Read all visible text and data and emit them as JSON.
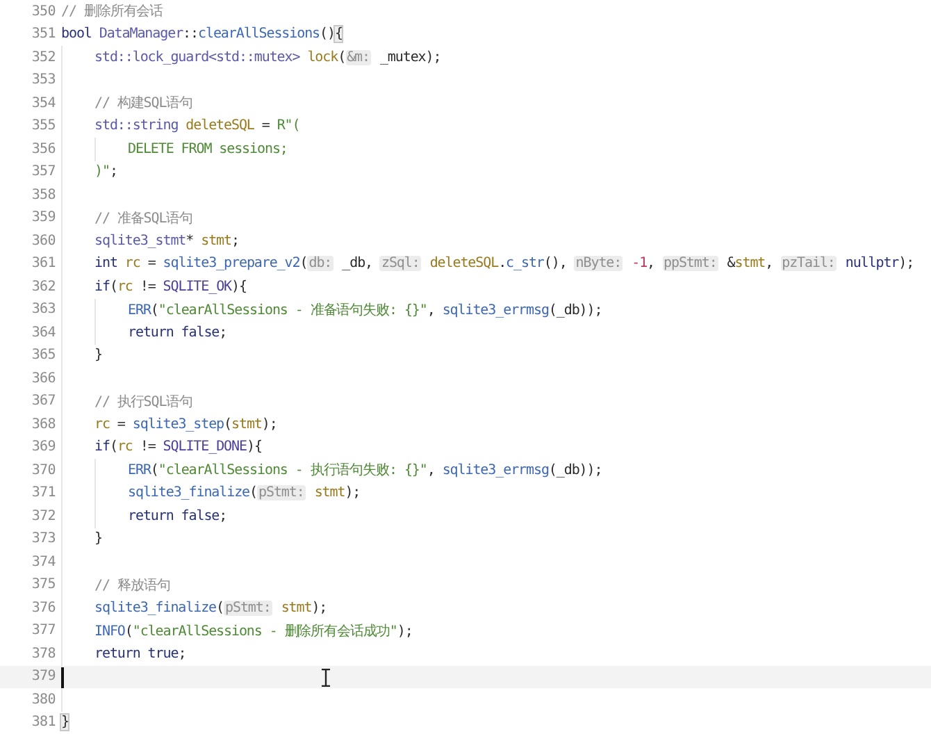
{
  "editor": {
    "lines": [
      {
        "number": "350",
        "current": false,
        "tokens": [
          {
            "kind": "comment",
            "t": "// 删除所有会话"
          }
        ]
      },
      {
        "number": "351",
        "current": false,
        "tokens": [
          {
            "kind": "kw",
            "t": "bool "
          },
          {
            "kind": "type",
            "t": "DataManager"
          },
          {
            "kind": "plain",
            "t": "::"
          },
          {
            "kind": "fn",
            "t": "clearAllSessions"
          },
          {
            "kind": "plain",
            "t": "()"
          },
          {
            "kind": "brace",
            "t": "{"
          }
        ]
      },
      {
        "number": "352",
        "current": false,
        "tokens": [
          {
            "kind": "type",
            "t": "    std::lock_guard<std::mutex> "
          },
          {
            "kind": "var",
            "t": "lock"
          },
          {
            "kind": "plain",
            "t": "("
          },
          {
            "kind": "hint",
            "t": "&m:"
          },
          {
            "kind": "plain",
            "t": " _mutex);"
          }
        ]
      },
      {
        "number": "353",
        "current": false
      },
      {
        "number": "354",
        "current": false,
        "tokens": [
          {
            "kind": "comment",
            "t": "    // 构建SQL语句"
          }
        ]
      },
      {
        "number": "355",
        "current": false,
        "tokens": [
          {
            "kind": "type",
            "t": "    std::string "
          },
          {
            "kind": "var",
            "t": "deleteSQL"
          },
          {
            "kind": "plain",
            "t": " = "
          },
          {
            "kind": "str",
            "t": "R\"("
          }
        ]
      },
      {
        "number": "356",
        "current": false,
        "tokens": [
          {
            "kind": "str",
            "t": "        DELETE FROM sessions;"
          }
        ]
      },
      {
        "number": "357",
        "current": false,
        "tokens": [
          {
            "kind": "str",
            "t": "    )\""
          },
          {
            "kind": "plain",
            "t": ";"
          }
        ]
      },
      {
        "number": "358",
        "current": false
      },
      {
        "number": "359",
        "current": false,
        "tokens": [
          {
            "kind": "comment",
            "t": "    // 准备SQL语句"
          }
        ]
      },
      {
        "number": "360",
        "current": false,
        "tokens": [
          {
            "kind": "type",
            "t": "    sqlite3_stmt"
          },
          {
            "kind": "plain",
            "t": "* "
          },
          {
            "kind": "var",
            "t": "stmt"
          },
          {
            "kind": "plain",
            "t": ";"
          }
        ]
      },
      {
        "number": "361",
        "current": false,
        "tokens": [
          {
            "kind": "kw",
            "t": "    int "
          },
          {
            "kind": "var",
            "t": "rc"
          },
          {
            "kind": "plain",
            "t": " = "
          },
          {
            "kind": "fn",
            "t": "sqlite3_prepare_v2"
          },
          {
            "kind": "plain",
            "t": "("
          },
          {
            "kind": "hint",
            "t": "db:"
          },
          {
            "kind": "plain",
            "t": " _db, "
          },
          {
            "kind": "hint",
            "t": "zSql:"
          },
          {
            "kind": "var",
            "t": " deleteSQL"
          },
          {
            "kind": "plain",
            "t": "."
          },
          {
            "kind": "fn",
            "t": "c_str"
          },
          {
            "kind": "plain",
            "t": "(), "
          },
          {
            "kind": "hint",
            "t": "nByte:"
          },
          {
            "kind": "num",
            "t": " -1"
          },
          {
            "kind": "plain",
            "t": ", "
          },
          {
            "kind": "hint",
            "t": "ppStmt:"
          },
          {
            "kind": "plain",
            "t": " &"
          },
          {
            "kind": "var",
            "t": "stmt"
          },
          {
            "kind": "plain",
            "t": ", "
          },
          {
            "kind": "hint",
            "t": "pzTail:"
          },
          {
            "kind": "kw",
            "t": " nullptr"
          },
          {
            "kind": "plain",
            "t": ");"
          }
        ]
      },
      {
        "number": "362",
        "current": false,
        "tokens": [
          {
            "kind": "kw",
            "t": "    if"
          },
          {
            "kind": "plain",
            "t": "("
          },
          {
            "kind": "var",
            "t": "rc"
          },
          {
            "kind": "plain",
            "t": " != "
          },
          {
            "kind": "const",
            "t": "SQLITE_OK"
          },
          {
            "kind": "plain",
            "t": "){"
          }
        ]
      },
      {
        "number": "363",
        "current": false,
        "tokens": [
          {
            "kind": "macro",
            "t": "        ERR"
          },
          {
            "kind": "plain",
            "t": "("
          },
          {
            "kind": "str",
            "t": "\"clearAllSessions - 准备语句失败: {}\""
          },
          {
            "kind": "plain",
            "t": ", "
          },
          {
            "kind": "fn",
            "t": "sqlite3_errmsg"
          },
          {
            "kind": "plain",
            "t": "(_db));"
          }
        ]
      },
      {
        "number": "364",
        "current": false,
        "tokens": [
          {
            "kind": "kw",
            "t": "        return false"
          },
          {
            "kind": "plain",
            "t": ";"
          }
        ]
      },
      {
        "number": "365",
        "current": false,
        "tokens": [
          {
            "kind": "plain",
            "t": "    }"
          }
        ]
      },
      {
        "number": "366",
        "current": false
      },
      {
        "number": "367",
        "current": false,
        "tokens": [
          {
            "kind": "comment",
            "t": "    // 执行SQL语句"
          }
        ]
      },
      {
        "number": "368",
        "current": false,
        "tokens": [
          {
            "kind": "var",
            "t": "    rc"
          },
          {
            "kind": "plain",
            "t": " = "
          },
          {
            "kind": "fn",
            "t": "sqlite3_step"
          },
          {
            "kind": "plain",
            "t": "("
          },
          {
            "kind": "var",
            "t": "stmt"
          },
          {
            "kind": "plain",
            "t": ");"
          }
        ]
      },
      {
        "number": "369",
        "current": false,
        "tokens": [
          {
            "kind": "kw",
            "t": "    if"
          },
          {
            "kind": "plain",
            "t": "("
          },
          {
            "kind": "var",
            "t": "rc"
          },
          {
            "kind": "plain",
            "t": " != "
          },
          {
            "kind": "const",
            "t": "SQLITE_DONE"
          },
          {
            "kind": "plain",
            "t": "){"
          }
        ]
      },
      {
        "number": "370",
        "current": false,
        "tokens": [
          {
            "kind": "macro",
            "t": "        ERR"
          },
          {
            "kind": "plain",
            "t": "("
          },
          {
            "kind": "str",
            "t": "\"clearAllSessions - 执行语句失败: {}\""
          },
          {
            "kind": "plain",
            "t": ", "
          },
          {
            "kind": "fn",
            "t": "sqlite3_errmsg"
          },
          {
            "kind": "plain",
            "t": "(_db));"
          }
        ]
      },
      {
        "number": "371",
        "current": false,
        "tokens": [
          {
            "kind": "fn",
            "t": "        sqlite3_finalize"
          },
          {
            "kind": "plain",
            "t": "("
          },
          {
            "kind": "hint",
            "t": "pStmt:"
          },
          {
            "kind": "var",
            "t": " stmt"
          },
          {
            "kind": "plain",
            "t": ");"
          }
        ]
      },
      {
        "number": "372",
        "current": false,
        "tokens": [
          {
            "kind": "kw",
            "t": "        return false"
          },
          {
            "kind": "plain",
            "t": ";"
          }
        ]
      },
      {
        "number": "373",
        "current": false,
        "tokens": [
          {
            "kind": "plain",
            "t": "    }"
          }
        ]
      },
      {
        "number": "374",
        "current": false
      },
      {
        "number": "375",
        "current": false,
        "tokens": [
          {
            "kind": "comment",
            "t": "    // 释放语句"
          }
        ]
      },
      {
        "number": "376",
        "current": false,
        "tokens": [
          {
            "kind": "fn",
            "t": "    sqlite3_finalize"
          },
          {
            "kind": "plain",
            "t": "("
          },
          {
            "kind": "hint",
            "t": "pStmt:"
          },
          {
            "kind": "var",
            "t": " stmt"
          },
          {
            "kind": "plain",
            "t": ");"
          }
        ]
      },
      {
        "number": "377",
        "current": false,
        "tokens": [
          {
            "kind": "macro",
            "t": "    INFO"
          },
          {
            "kind": "plain",
            "t": "("
          },
          {
            "kind": "str",
            "t": "\"clearAllSessions - 删除所有会话成功\""
          },
          {
            "kind": "plain",
            "t": ");"
          }
        ]
      },
      {
        "number": "378",
        "current": false,
        "tokens": [
          {
            "kind": "kw",
            "t": "    return true"
          },
          {
            "kind": "plain",
            "t": ";"
          }
        ]
      },
      {
        "number": "379",
        "current": true
      },
      {
        "number": "380",
        "current": false
      },
      {
        "number": "381",
        "current": false,
        "tokens": [
          {
            "kind": "brace",
            "t": "}"
          }
        ]
      }
    ]
  }
}
